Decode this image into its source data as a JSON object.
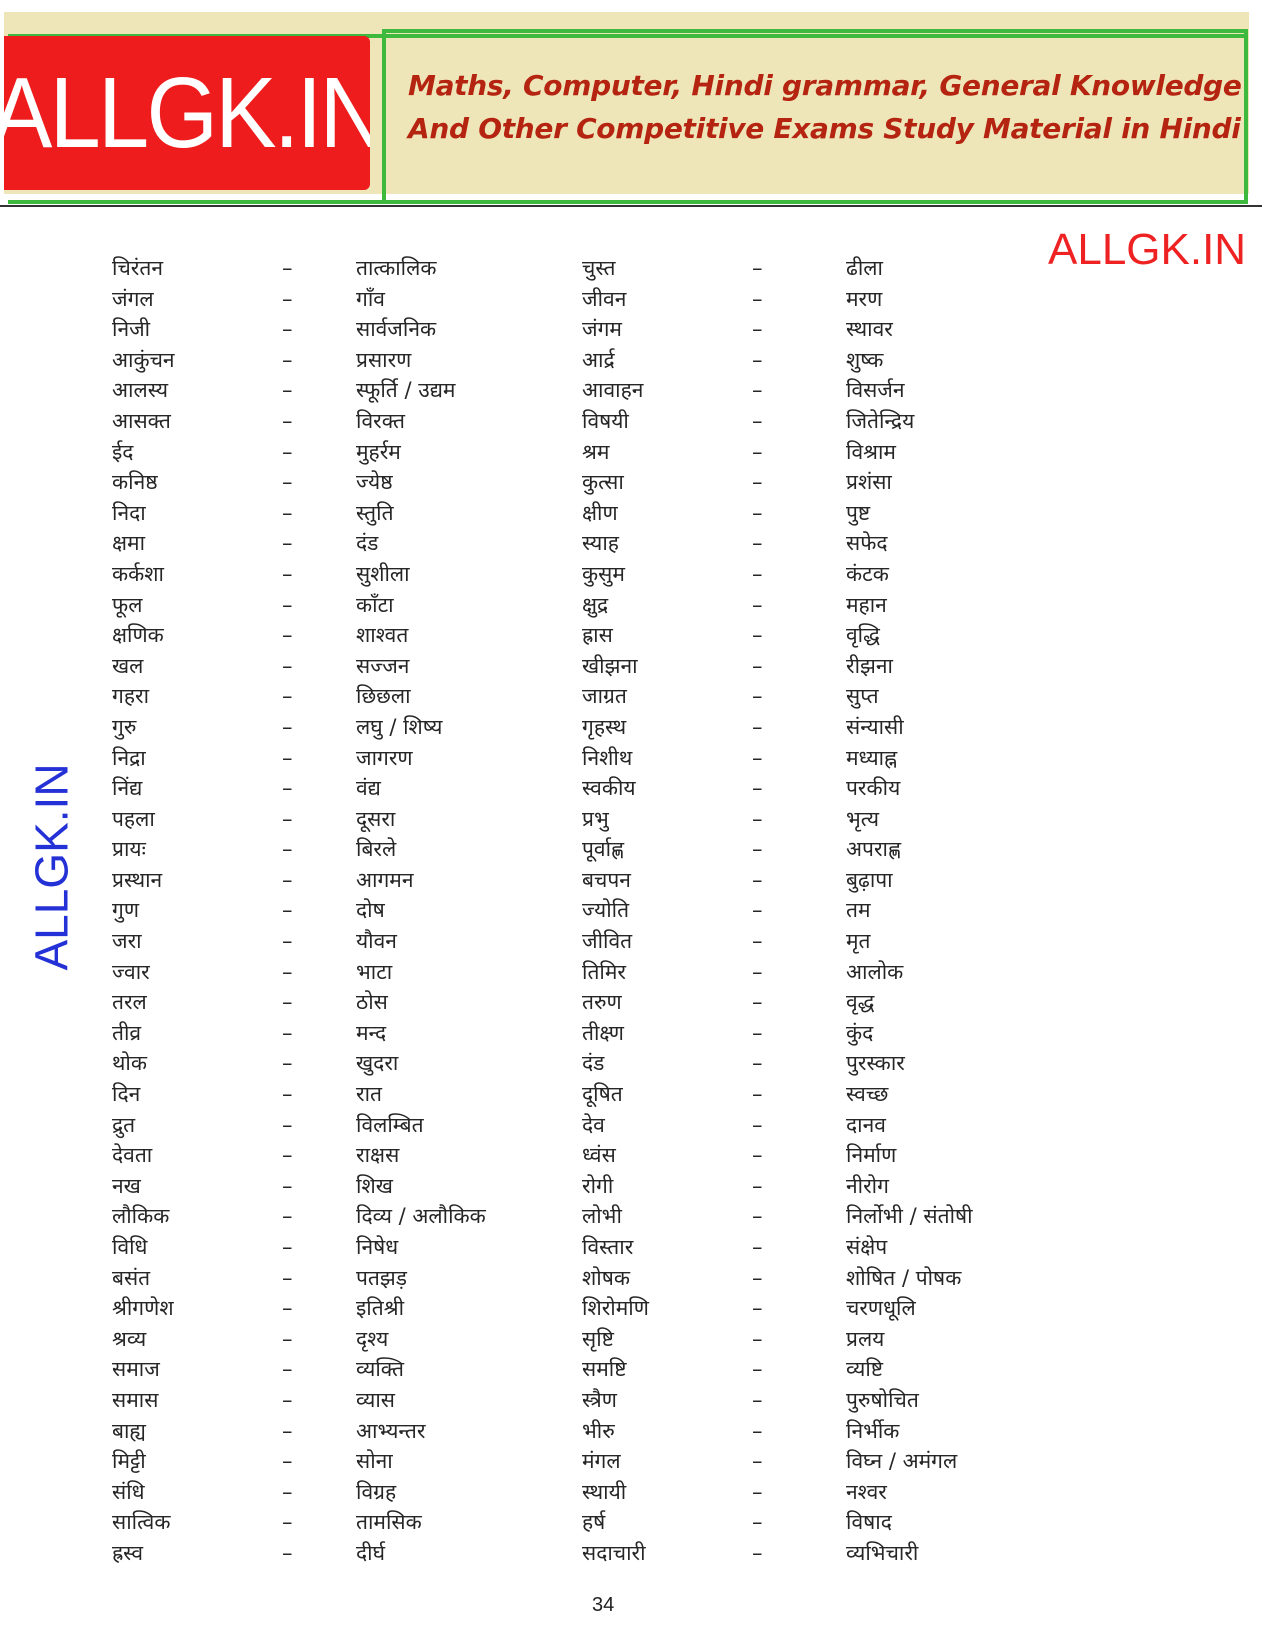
{
  "header": {
    "logo_text": "ALLGK.IN",
    "tagline_line1": "Maths, Computer, Hindi grammar, General Knowledge",
    "tagline_line2": "And Other Competitive Exams Study Material in Hindi",
    "colors": {
      "banner_bg": "#eee6b8",
      "logo_bg": "#ee1c1c",
      "frame_green": "#3dba3d",
      "tagline": "#b52410"
    }
  },
  "watermarks": {
    "right": "ALLGK.IN",
    "left": "ALLGK.IN",
    "right_color": "#ee2222",
    "left_color": "#2431d6"
  },
  "dash": "–",
  "rows": [
    [
      "चिरंतन",
      "तात्कालिक",
      "चुस्त",
      "ढीला"
    ],
    [
      "जंगल",
      "गाँव",
      "जीवन",
      "मरण"
    ],
    [
      "निजी",
      "सार्वजनिक",
      "जंगम",
      "स्थावर"
    ],
    [
      "आकुंचन",
      "प्रसारण",
      "आर्द्र",
      "शुष्क"
    ],
    [
      "आलस्य",
      "स्फूर्ति / उद्यम",
      "आवाहन",
      "विसर्जन"
    ],
    [
      "आसक्त",
      "विरक्त",
      "विषयी",
      "जितेन्द्रिय"
    ],
    [
      "ईद",
      "मुहर्रम",
      "श्रम",
      "विश्राम"
    ],
    [
      "कनिष्ठ",
      "ज्येष्ठ",
      "कुत्सा",
      "प्रशंसा"
    ],
    [
      "निदा",
      "स्तुति",
      "क्षीण",
      "पुष्ट"
    ],
    [
      "क्षमा",
      "दंड",
      "स्याह",
      "सफेद"
    ],
    [
      "कर्कशा",
      "सुशीला",
      "कुसुम",
      "कंटक"
    ],
    [
      "फूल",
      "काँटा",
      "क्षुद्र",
      "महान"
    ],
    [
      "क्षणिक",
      "शाश्वत",
      "ह्रास",
      "वृद्धि"
    ],
    [
      "खल",
      "सज्जन",
      "खीझना",
      "रीझना"
    ],
    [
      "गहरा",
      "छिछला",
      "जाग्रत",
      "सुप्त"
    ],
    [
      "गुरु",
      "लघु / शिष्य",
      "गृहस्थ",
      "संन्यासी"
    ],
    [
      "निद्रा",
      "जागरण",
      "निशीथ",
      "मध्याह्न"
    ],
    [
      "निंद्य",
      "वंद्य",
      "स्वकीय",
      "परकीय"
    ],
    [
      "पहला",
      "दूसरा",
      "प्रभु",
      "भृत्य"
    ],
    [
      "प्रायः",
      "बिरले",
      "पूर्वाह्ण",
      "अपराह्ण"
    ],
    [
      "प्रस्थान",
      "आगमन",
      "बचपन",
      "बुढ़ापा"
    ],
    [
      "गुण",
      "दोष",
      "ज्योति",
      "तम"
    ],
    [
      "जरा",
      "यौवन",
      "जीवित",
      "मृत"
    ],
    [
      "ज्वार",
      "भाटा",
      "तिमिर",
      "आलोक"
    ],
    [
      "तरल",
      "ठोस",
      "तरुण",
      "वृद्ध"
    ],
    [
      "तीव्र",
      "मन्द",
      "तीक्ष्ण",
      "कुंद"
    ],
    [
      "थोक",
      "खुदरा",
      "दंड",
      "पुरस्कार"
    ],
    [
      "दिन",
      "रात",
      "दूषित",
      "स्वच्छ"
    ],
    [
      "द्रुत",
      "विलम्बित",
      "देव",
      "दानव"
    ],
    [
      "देवता",
      "राक्षस",
      "ध्वंस",
      "निर्माण"
    ],
    [
      "नख",
      "शिख",
      "रोगी",
      "नीरोग"
    ],
    [
      "लौकिक",
      "दिव्य / अलौकिक",
      "लोभी",
      "निर्लोभी / संतोषी"
    ],
    [
      "विधि",
      "निषेध",
      "विस्तार",
      "संक्षेप"
    ],
    [
      "बसंत",
      "पतझड़",
      "शोषक",
      "शोषित / पोषक"
    ],
    [
      "श्रीगणेश",
      "इतिश्री",
      "शिरोमणि",
      "चरणधूलि"
    ],
    [
      "श्रव्य",
      "दृश्य",
      "सृष्टि",
      "प्रलय"
    ],
    [
      "समाज",
      "व्यक्ति",
      "समष्टि",
      "व्यष्टि"
    ],
    [
      "समास",
      "व्यास",
      "स्त्रैण",
      "पुरुषोचित"
    ],
    [
      "बाह्य",
      "आभ्यन्तर",
      "भीरु",
      "निर्भीक"
    ],
    [
      "मिट्टी",
      "सोना",
      "मंगल",
      "विघ्न / अमंगल"
    ],
    [
      "संधि",
      "विग्रह",
      "स्थायी",
      "नश्वर"
    ],
    [
      "सात्विक",
      "तामसिक",
      "हर्ष",
      "विषाद"
    ],
    [
      "ह्रस्व",
      "दीर्घ",
      "सदाचारी",
      "व्यभिचारी"
    ]
  ],
  "page_number": "34"
}
